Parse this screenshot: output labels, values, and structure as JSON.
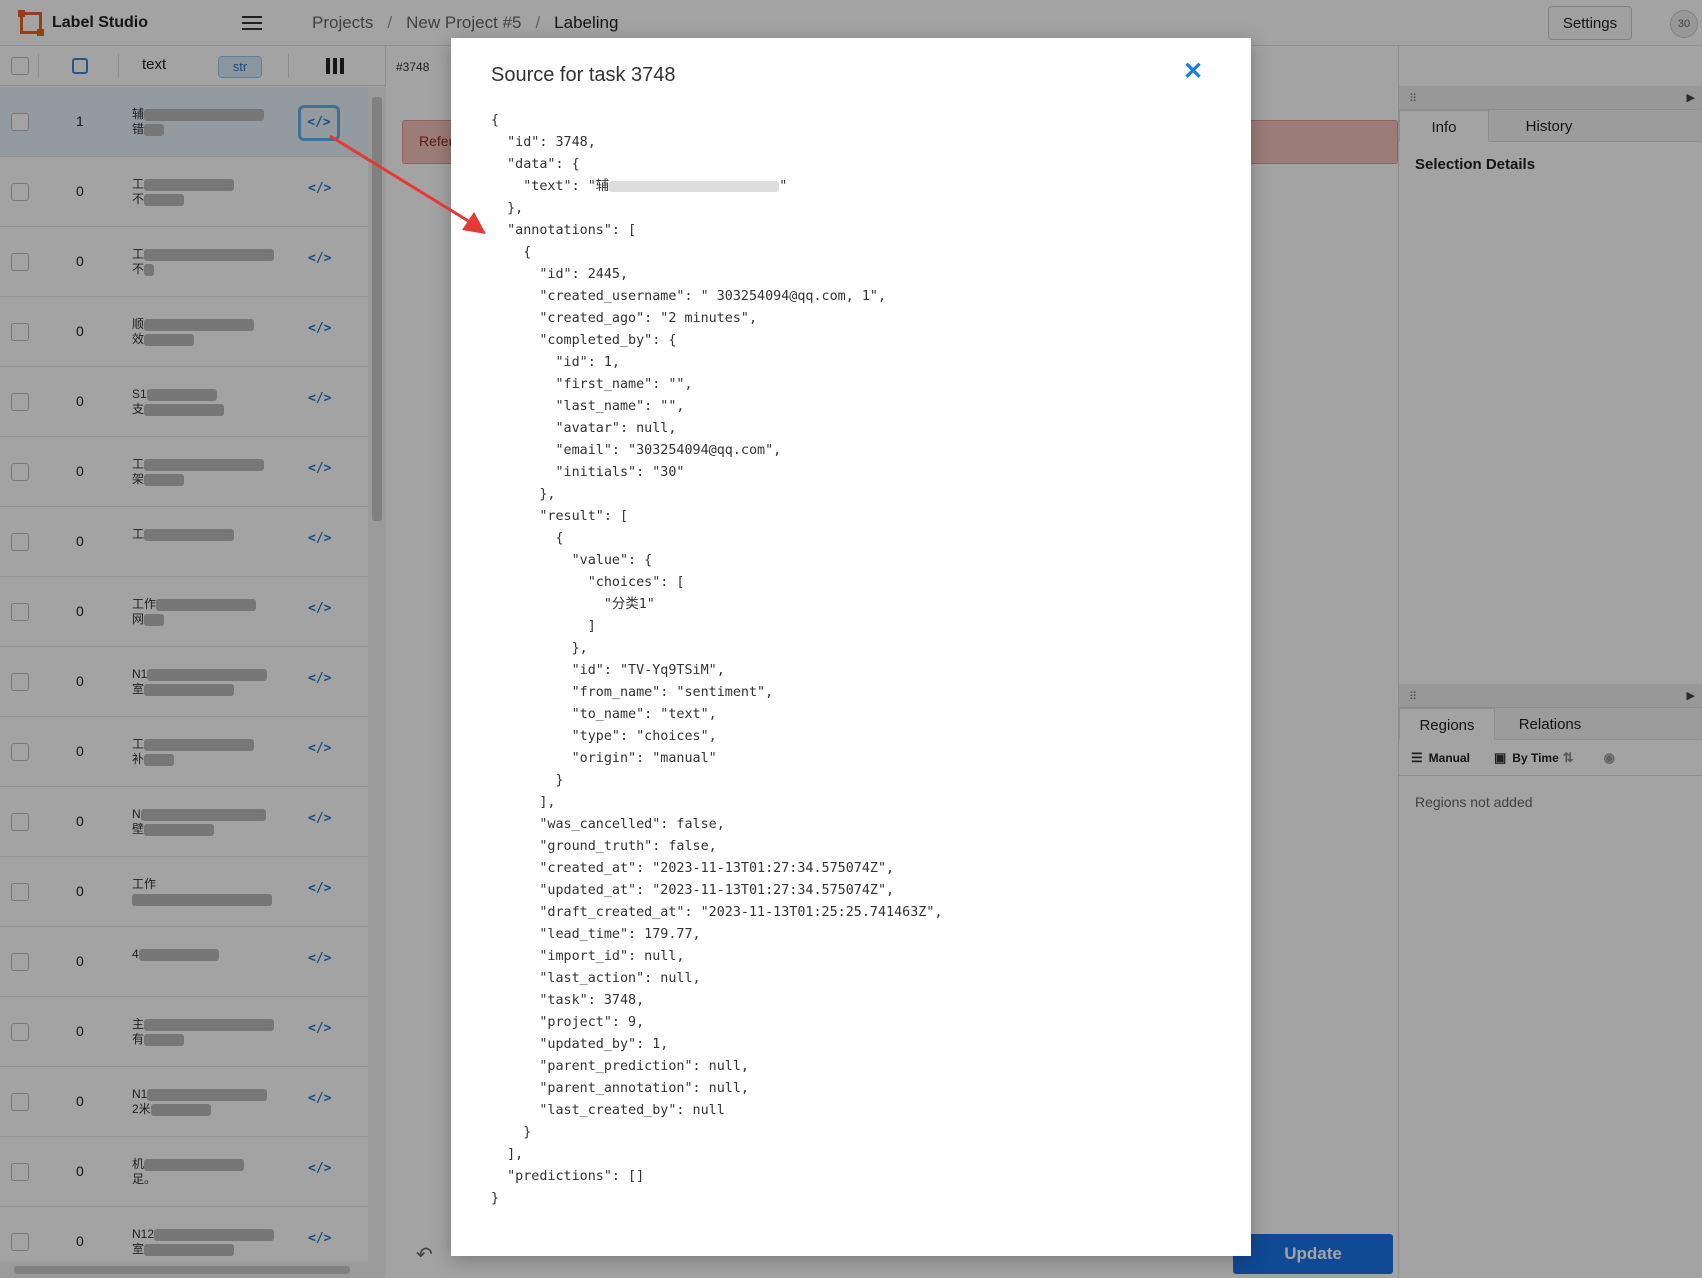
{
  "app": {
    "name": "Label Studio",
    "breadcrumb": [
      "Projects",
      "New Project #5",
      "Labeling"
    ],
    "settings_label": "Settings",
    "avatar_initials": "30"
  },
  "list": {
    "header": {
      "column_label": "text",
      "type_tag": "str"
    },
    "rows": [
      {
        "count": "1",
        "text_start": "辅",
        "text_line2": "错"
      },
      {
        "count": "0",
        "text_start": "工",
        "text_line2": "不"
      },
      {
        "count": "0",
        "text_start": "工",
        "text_line2": "不"
      },
      {
        "count": "0",
        "text_start": "顺",
        "text_line2": "效"
      },
      {
        "count": "0",
        "text_start": "S1",
        "text_line2": "支"
      },
      {
        "count": "0",
        "text_start": "工",
        "text_line2": "架"
      },
      {
        "count": "0",
        "text_start": "工",
        "text_line2": ""
      },
      {
        "count": "0",
        "text_start": "工作",
        "text_line2": "网"
      },
      {
        "count": "0",
        "text_start": "N1",
        "text_line2": "室"
      },
      {
        "count": "0",
        "text_start": "工",
        "text_line2": "补"
      },
      {
        "count": "0",
        "text_start": "N",
        "text_line2": "壁"
      },
      {
        "count": "0",
        "text_start": "工作",
        "text_line2": ""
      },
      {
        "count": "0",
        "text_start": "4",
        "text_line2": ""
      },
      {
        "count": "0",
        "text_start": "主",
        "text_line2": "有"
      },
      {
        "count": "0",
        "text_start": "N1",
        "text_line2": "2米"
      },
      {
        "count": "0",
        "text_start": "机",
        "text_line2": "足。"
      },
      {
        "count": "0",
        "text_start": "N12",
        "text_line2": "室"
      }
    ],
    "source_icon": "</>"
  },
  "center": {
    "task_id": "#3748",
    "alert_text": "Refer",
    "update_label": "Update"
  },
  "right": {
    "tabs_top": [
      "Info",
      "History"
    ],
    "selection_title": "Selection Details",
    "tabs_bottom": [
      "Regions",
      "Relations"
    ],
    "toolbar": {
      "manual": "Manual",
      "by_time": "By Time"
    },
    "regions_empty": "Regions not added"
  },
  "modal": {
    "title": "Source for task 3748",
    "code_lines": [
      "{",
      "  \"id\": 3748,",
      "  \"data\": {",
      "    \"text\": \"辅",
      "  },",
      "  \"annotations\": [",
      "    {",
      "      \"id\": 2445,",
      "      \"created_username\": \" 303254094@qq.com, 1\",",
      "      \"created_ago\": \"2 minutes\",",
      "      \"completed_by\": {",
      "        \"id\": 1,",
      "        \"first_name\": \"\",",
      "        \"last_name\": \"\",",
      "        \"avatar\": null,",
      "        \"email\": \"303254094@qq.com\",",
      "        \"initials\": \"30\"",
      "      },",
      "      \"result\": [",
      "        {",
      "          \"value\": {",
      "            \"choices\": [",
      "              \"分类1\"",
      "            ]",
      "          },",
      "          \"id\": \"TV-Yq9TSiM\",",
      "          \"from_name\": \"sentiment\",",
      "          \"to_name\": \"text\",",
      "          \"type\": \"choices\",",
      "          \"origin\": \"manual\"",
      "        }",
      "      ],",
      "      \"was_cancelled\": false,",
      "      \"ground_truth\": false,",
      "      \"created_at\": \"2023-11-13T01:27:34.575074Z\",",
      "      \"updated_at\": \"2023-11-13T01:27:34.575074Z\",",
      "      \"draft_created_at\": \"2023-11-13T01:25:25.741463Z\",",
      "      \"lead_time\": 179.77,",
      "      \"import_id\": null,",
      "      \"last_action\": null,",
      "      \"task\": 3748,",
      "      \"project\": 9,",
      "      \"updated_by\": 1,",
      "      \"parent_prediction\": null,",
      "      \"parent_annotation\": null,",
      "      \"last_created_by\": null",
      "    }",
      "  ],",
      "  \"predictions\": []",
      "}"
    ]
  },
  "colors": {
    "accent": "#1a73e8",
    "close": "#1a7ee0",
    "alert_bg": "#f3c2bc",
    "annotation_arrow": "#e53935"
  }
}
